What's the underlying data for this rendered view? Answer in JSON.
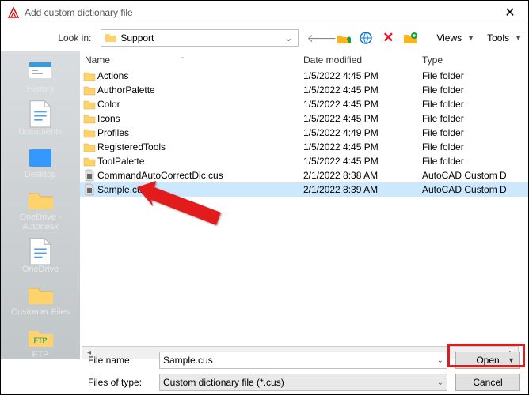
{
  "window": {
    "title": "Add custom dictionary file"
  },
  "lookin": {
    "label": "Look in:",
    "value": "Support"
  },
  "toolbar": {
    "views": "Views",
    "tools": "Tools"
  },
  "places": [
    {
      "name": "History",
      "icon": "history"
    },
    {
      "name": "Documents",
      "icon": "document"
    },
    {
      "name": "Desktop",
      "icon": "desktop"
    },
    {
      "name": "OneDrive - Autodesk",
      "icon": "folder"
    },
    {
      "name": "OneDrive",
      "icon": "document"
    },
    {
      "name": "Customer Files",
      "icon": "folder"
    },
    {
      "name": "FTP",
      "icon": "ftp"
    }
  ],
  "columns": {
    "name": "Name",
    "date": "Date modified",
    "type": "Type"
  },
  "files": [
    {
      "name": "Actions",
      "date": "1/5/2022 4:45 PM",
      "type": "File folder",
      "kind": "folder"
    },
    {
      "name": "AuthorPalette",
      "date": "1/5/2022 4:45 PM",
      "type": "File folder",
      "kind": "folder"
    },
    {
      "name": "Color",
      "date": "1/5/2022 4:45 PM",
      "type": "File folder",
      "kind": "folder"
    },
    {
      "name": "Icons",
      "date": "1/5/2022 4:45 PM",
      "type": "File folder",
      "kind": "folder"
    },
    {
      "name": "Profiles",
      "date": "1/5/2022 4:49 PM",
      "type": "File folder",
      "kind": "folder"
    },
    {
      "name": "RegisteredTools",
      "date": "1/5/2022 4:45 PM",
      "type": "File folder",
      "kind": "folder"
    },
    {
      "name": "ToolPalette",
      "date": "1/5/2022 4:45 PM",
      "type": "File folder",
      "kind": "folder"
    },
    {
      "name": "CommandAutoCorrectDic.cus",
      "date": "2/1/2022 8:38 AM",
      "type": "AutoCAD Custom D",
      "kind": "file"
    },
    {
      "name": "Sample.cus",
      "date": "2/1/2022 8:39 AM",
      "type": "AutoCAD Custom D",
      "kind": "file",
      "selected": true
    }
  ],
  "filename": {
    "label": "File name:",
    "value": "Sample.cus"
  },
  "filetype": {
    "label": "Files of type:",
    "value": "Custom dictionary file (*.cus)"
  },
  "buttons": {
    "open": "Open",
    "cancel": "Cancel"
  }
}
